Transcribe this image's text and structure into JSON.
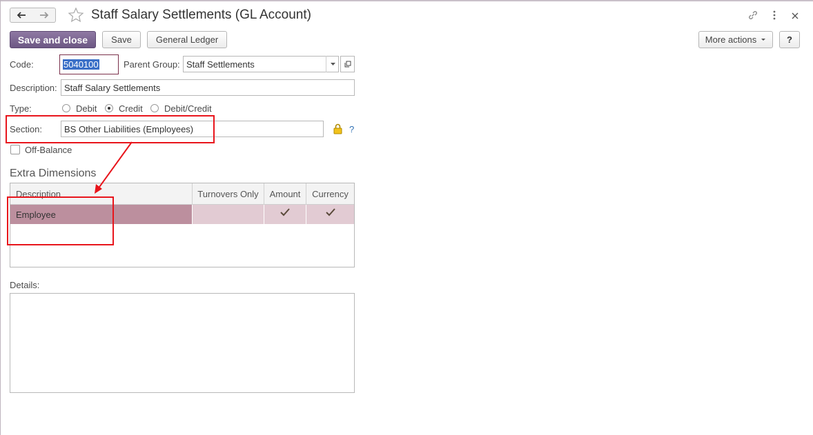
{
  "window": {
    "title": "Staff Salary Settlements (GL Account)"
  },
  "toolbar": {
    "save_close_label": "Save and close",
    "save_label": "Save",
    "general_ledger_label": "General Ledger",
    "more_actions_label": "More actions",
    "help_label": "?"
  },
  "form": {
    "code_label": "Code:",
    "code_value": "5040100",
    "parent_group_label": "Parent Group:",
    "parent_group_value": "Staff Settlements",
    "description_label": "Description:",
    "description_value": "Staff Salary Settlements",
    "type_label": "Type:",
    "type_options": [
      "Debit",
      "Credit",
      "Debit/Credit"
    ],
    "type_selected": "Credit",
    "section_label": "Section:",
    "section_value": "BS Other Liabilities (Employees)",
    "section_help": "?",
    "off_balance_label": "Off-Balance",
    "off_balance_checked": false
  },
  "extra_dimensions": {
    "title": "Extra Dimensions",
    "columns": [
      "Description",
      "Turnovers Only",
      "Amount",
      "Currency"
    ],
    "rows": [
      {
        "description": "Employee",
        "turnovers_only": false,
        "amount": true,
        "currency": true
      }
    ]
  },
  "details": {
    "label": "Details:",
    "value": ""
  },
  "colors": {
    "accent": "#7b6592",
    "row_selected": "#bc8f9e",
    "row_light": "#e2cbd3",
    "annotation": "#e8141b"
  }
}
